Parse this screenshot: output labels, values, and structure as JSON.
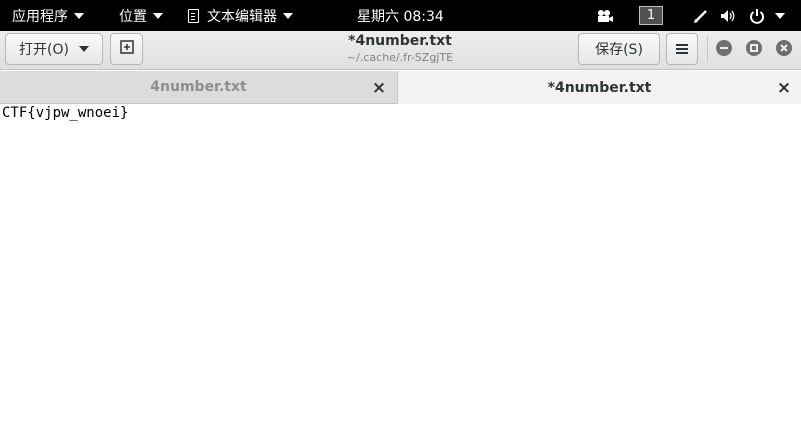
{
  "top_bar": {
    "applications_label": "应用程序",
    "places_label": "位置",
    "app_menu_label": "文本编辑器",
    "clock": "星期六 08:34",
    "workspace_number": "1"
  },
  "header": {
    "open_label": "打开(O)",
    "title": "*4number.txt",
    "subtitle": "~/.cache/.fr-SZgjTE",
    "save_label": "保存(S)"
  },
  "tabs": [
    {
      "label": "4number.txt",
      "active": false
    },
    {
      "label": "*4number.txt",
      "active": true
    }
  ],
  "editor": {
    "lines": [
      "CTF{vjpw_wnoei}"
    ]
  },
  "icons": {
    "camera": "camera-icon",
    "pen": "pen-icon",
    "volume": "volume-icon",
    "power": "power-icon",
    "new_document": "new-document-icon",
    "menu": "hamburger-menu-icon",
    "close": "close-icon"
  }
}
